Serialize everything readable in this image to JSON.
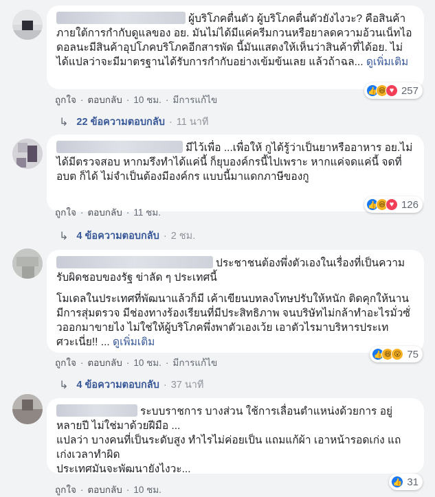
{
  "comments": [
    {
      "text": "ผู้บริโภคตื่นตัว ผู้บริโภคตื่นตัวยังไงวะ? คือสินค้าภายใต้การกำกับดูแลของ อย. มันไม่ได้มีแค่ครีมกวนหรือยาลดความอ้วนเน็ทไอดอลนะมีสินค้าอุปโภคบริโภคอีกสารพัด นี้มันแสดงให้เห็นว่าสินค้าที่ได้อย. ไม่ได้แปลว่าจะมีมาตรฐานได้รับการกำกับอย่างเข้มข้นเลย แล้วถ้าฉล...",
      "see_more": "ดูเพิ่มเติม",
      "reactions": [
        "like",
        "haha",
        "love"
      ],
      "reaction_count": "257",
      "like_label": "ถูกใจ",
      "reply_label": "ตอบกลับ",
      "time": "10 ชม.",
      "edited": "มีการแก้ไข",
      "replies_label": "22 ข้อความตอบกลับ",
      "replies_time": "11 นาที"
    },
    {
      "text": "มีไว้เพื่อ ...เพื่อให้ กูได้รู้ว่าเป็นยาหรืออาหาร อย.ไม่ได้มีตรวจสอบ หากมรึงทำได้แค่นี้ ก็ยุบองค์กรนี้ไปเพราะ หากแค่จดแค่นี้ จดที่ อบต ก็ได้ ไม่จำเป็นต้องมีองค์กร แบบนี้มาแดกภาษีของกู",
      "reactions": [
        "like",
        "haha",
        "love"
      ],
      "reaction_count": "126",
      "like_label": "ถูกใจ",
      "reply_label": "ตอบกลับ",
      "time": "11 ชม.",
      "replies_label": "4 ข้อความตอบกลับ",
      "replies_time": "2 ชม."
    },
    {
      "text_1": "ประชาชนต้องพึ่งตัวเองในเรื่องที่เป็นความรับผิดชอบของรัฐ ข่าลัด ๆ ประเทศนี้",
      "text_2": "โมเดลในประเทศที่พัฒนาแล้วก็มี เค้าเขียนบทลงโทษปรับให้หนัก ติดคุกให้นาน มีการสุ่มตรวจ มีช่องทางร้องเรียนที่มีประสิทธิภาพ จนบริษัทไม่กล้าทำอะไรมั่วซั่วออกมาขายไง ไม่ใช่ให้ผู้บริโภคพึ่งพาตัวเองเว้ย เอาตัวไรมาบริหารประเทศวะเนี่ย!! ...",
      "see_more": "ดูเพิ่มเติม",
      "reactions": [
        "like",
        "haha",
        "wow"
      ],
      "reaction_count": "75",
      "like_label": "ถูกใจ",
      "reply_label": "ตอบกลับ",
      "time": "10 ชม.",
      "edited": "มีการแก้ไข",
      "replies_label": "4 ข้อความตอบกลับ",
      "replies_time": "37 นาที"
    },
    {
      "text_1": "ระบบราชการ บางส่วน ใช้การเลื่อนตำแหน่งด้วยการ อยู่หลายปี ไม่ใช่มาด้วยฝีมือ ...",
      "text_2": "แปลว่า บางคนที่เป็นระดับสูง ทำไรไม่ค่อยเป็น แถมแก้ผ้า เอาหน้ารอดเก่ง แถเก่งเวลาทำผิด\nประเทศมันจะพัฒนายังไงวะ...",
      "reactions": [
        "like"
      ],
      "reaction_count": "31",
      "like_label": "ถูกใจ",
      "reply_label": "ตอบกลับ",
      "time": "10 ชม."
    }
  ]
}
